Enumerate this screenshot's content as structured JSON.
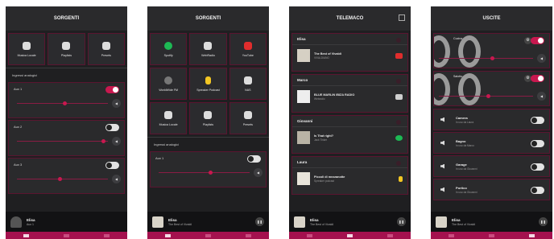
{
  "colors": {
    "accent": "#c8184f",
    "tabbar": "#a4114e",
    "bg": "#1f1f21",
    "card_border": "#5a1530"
  },
  "screen1": {
    "title": "SORGENTI",
    "tiles": [
      {
        "label": "Musica Locale",
        "icon": "phone-icon"
      },
      {
        "label": "Playlists",
        "icon": "playlist-icon"
      },
      {
        "label": "Presets",
        "icon": "bookmark-icon"
      }
    ],
    "section": "Ingressi analogici",
    "lines": [
      {
        "name": "Aux 1",
        "on": true,
        "level": 0.5
      },
      {
        "name": "Aux 2",
        "on": false,
        "level": 0.93
      },
      {
        "name": "Aux 3",
        "on": false,
        "level": 0.45
      }
    ],
    "player": {
      "title": "Elisa",
      "subtitle": "Aux 1"
    }
  },
  "screen2": {
    "title": "SORGENTI",
    "tiles": [
      {
        "label": "Spotify",
        "icon": "spotify-icon"
      },
      {
        "label": "WebRadio",
        "icon": "radio-icon"
      },
      {
        "label": "YouTube",
        "icon": "youtube-icon"
      },
      {
        "label": "WorldWide FM",
        "icon": "globe-icon"
      },
      {
        "label": "Spreaker Podcast",
        "icon": "podcast-icon"
      },
      {
        "label": "NAS",
        "icon": "nas-icon"
      },
      {
        "label": "Musica Locale",
        "icon": "phone-icon"
      },
      {
        "label": "Playlists",
        "icon": "playlist-icon"
      },
      {
        "label": "Presets",
        "icon": "bookmark-icon"
      }
    ],
    "section": "Ingressi analogici",
    "line": {
      "name": "Aux 1",
      "on": false,
      "level": 0.55
    },
    "player": {
      "title": "Elisa",
      "subtitle": "The Best of Vivaldi"
    }
  },
  "screen3": {
    "title": "TELEMACO",
    "rooms": [
      {
        "name": "Elisa",
        "track": "The Best of Vivaldi",
        "artist": "VIVALDIANO",
        "badge": "#e02d2d"
      },
      {
        "name": "Marco",
        "track": "BLUE MARLIN IBIZA RADIO",
        "artist": "Webradio",
        "badge": "#cfcfcf"
      },
      {
        "name": "Giovanni",
        "track": "Is That right?",
        "artist": "Jack Tinker",
        "badge": "#1db954"
      },
      {
        "name": "Laura",
        "track": "Piccoli di mezzanotte",
        "artist": "Spreaker podcast",
        "badge": "#f3c623"
      }
    ],
    "player": {
      "title": "Elisa",
      "subtitle": "The Best of Vivaldi"
    }
  },
  "screen4": {
    "title": "USCITE",
    "zones": [
      {
        "label": "Cucina",
        "level": 0.55
      },
      {
        "label": "Salotto",
        "level": 0.5
      }
    ],
    "outputs": [
      {
        "name": "Camera",
        "sub": "In uso da Laura"
      },
      {
        "name": "Bagno",
        "sub": "In uso da Marco"
      },
      {
        "name": "Garage",
        "sub": "In uso da Giovanni"
      },
      {
        "name": "Portico",
        "sub": "In uso da Giovanni"
      }
    ],
    "player": {
      "title": "Elisa",
      "subtitle": "The Best of Vivaldi"
    }
  }
}
